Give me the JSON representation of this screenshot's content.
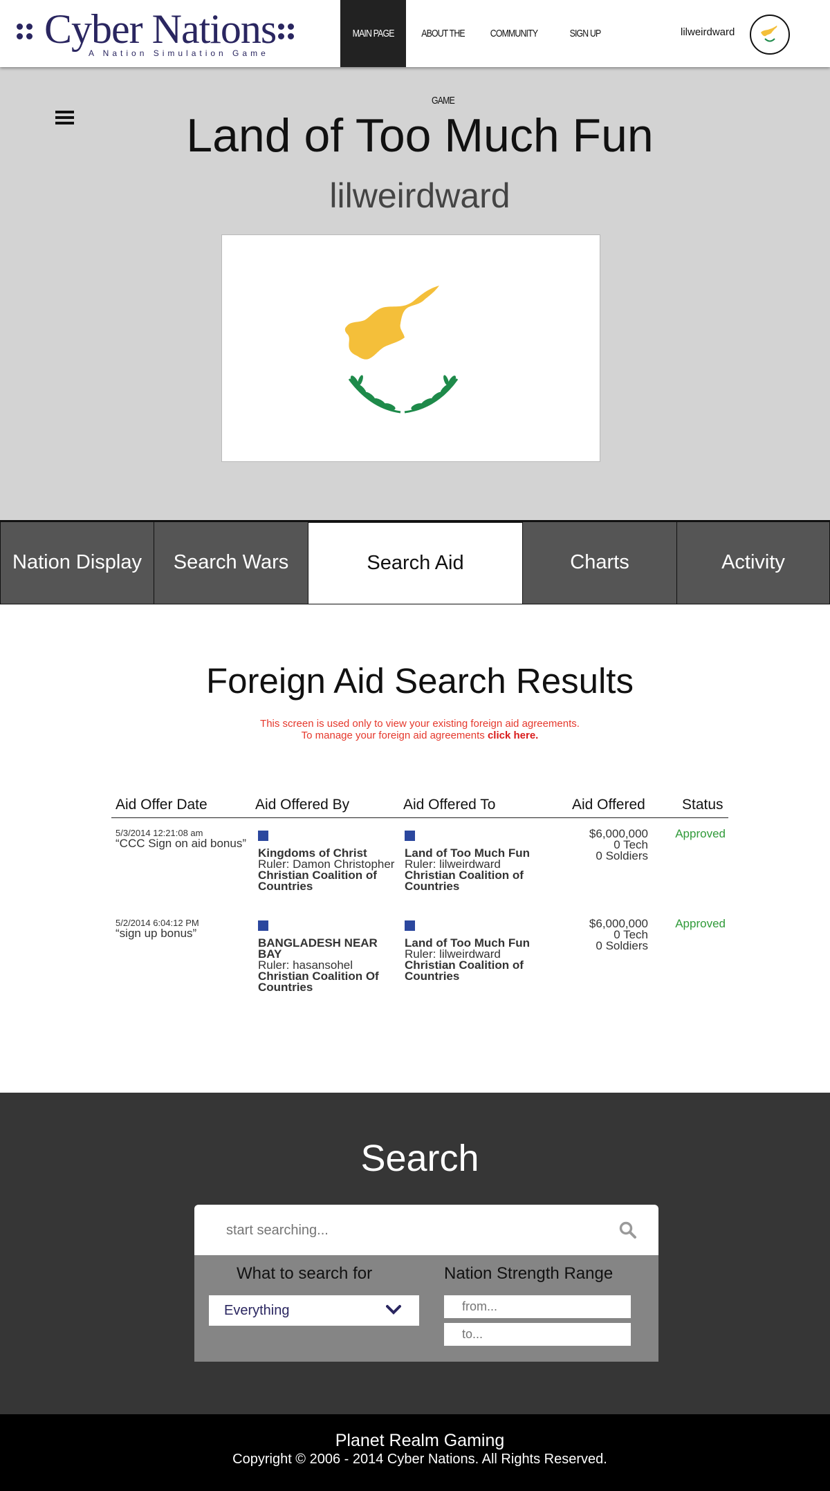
{
  "nav": {
    "logo_title": "Cyber Nations",
    "logo_subtitle": "A Nation Simulation Game",
    "links": [
      {
        "label": "MAIN PAGE"
      },
      {
        "label": "ABOUT THE GAME"
      },
      {
        "label": "COMMUNITY"
      },
      {
        "label": "SIGN UP"
      }
    ],
    "username": "lilweirdward"
  },
  "hero": {
    "nation_name": "Land of Too Much Fun",
    "ruler_name": "lilweirdward",
    "flag_icon": "cyprus-flag-icon"
  },
  "tabs": [
    {
      "label": "Nation Display"
    },
    {
      "label": "Search Wars"
    },
    {
      "label": "Search Aid"
    },
    {
      "label": "Charts"
    },
    {
      "label": "Activity"
    }
  ],
  "results": {
    "title": "Foreign Aid Search Results",
    "notice_line1": "This screen is used only to view your existing foreign aid agreements.",
    "notice_line2": "To manage your foreign aid agreements",
    "notice_link": "click here."
  },
  "table": {
    "headers": [
      "Aid Offer Date",
      "Aid Offered By",
      "Aid Offered To",
      "Aid Offered",
      "Status"
    ],
    "rows": [
      {
        "timestamp": "5/3/2014 12:21:08 am",
        "note": "“CCC Sign on aid bonus”",
        "by_nation": "Kingdoms of Christ",
        "by_ruler": "Ruler: Damon Christopher",
        "by_alliance": "Christian Coalition of Countries",
        "to_nation": "Land of Too Much Fun",
        "to_ruler": "Ruler: lilweirdward",
        "to_alliance": "Christian Coalition of Countries",
        "money": "$6,000,000",
        "tech": "0 Tech",
        "soldiers": "0 Soldiers",
        "status": "Approved"
      },
      {
        "timestamp": "5/2/2014 6:04:12 PM",
        "note": "“sign up bonus”",
        "by_nation": "BANGLADESH NEAR BAY",
        "by_ruler": "Ruler: hasansohel",
        "by_alliance": "Christian Coalition Of Countries",
        "to_nation": "Land of Too Much Fun",
        "to_ruler": "Ruler: lilweirdward",
        "to_alliance": "Christian Coalition of Countries",
        "money": "$6,000,000",
        "tech": "0 Tech",
        "soldiers": "0 Soldiers",
        "status": "Approved"
      }
    ]
  },
  "search": {
    "title": "Search",
    "placeholder": "start searching...",
    "what_label": "What to search for",
    "what_value": "Everything",
    "range_label": "Nation Strength Range",
    "from_placeholder": "from...",
    "to_placeholder": "to..."
  },
  "footer": {
    "line1": "Planet Realm Gaming",
    "line2": "Copyright © 2006 - 2014 Cyber Nations. All Rights Reserved."
  },
  "colors": {
    "brand": "#2a2660",
    "flag_copper": "#f4bf3a",
    "flag_olive": "#1e8a4a",
    "status_approved": "#2f9a38",
    "notice": "#e5382c",
    "alliance_square": "#2b479e"
  }
}
